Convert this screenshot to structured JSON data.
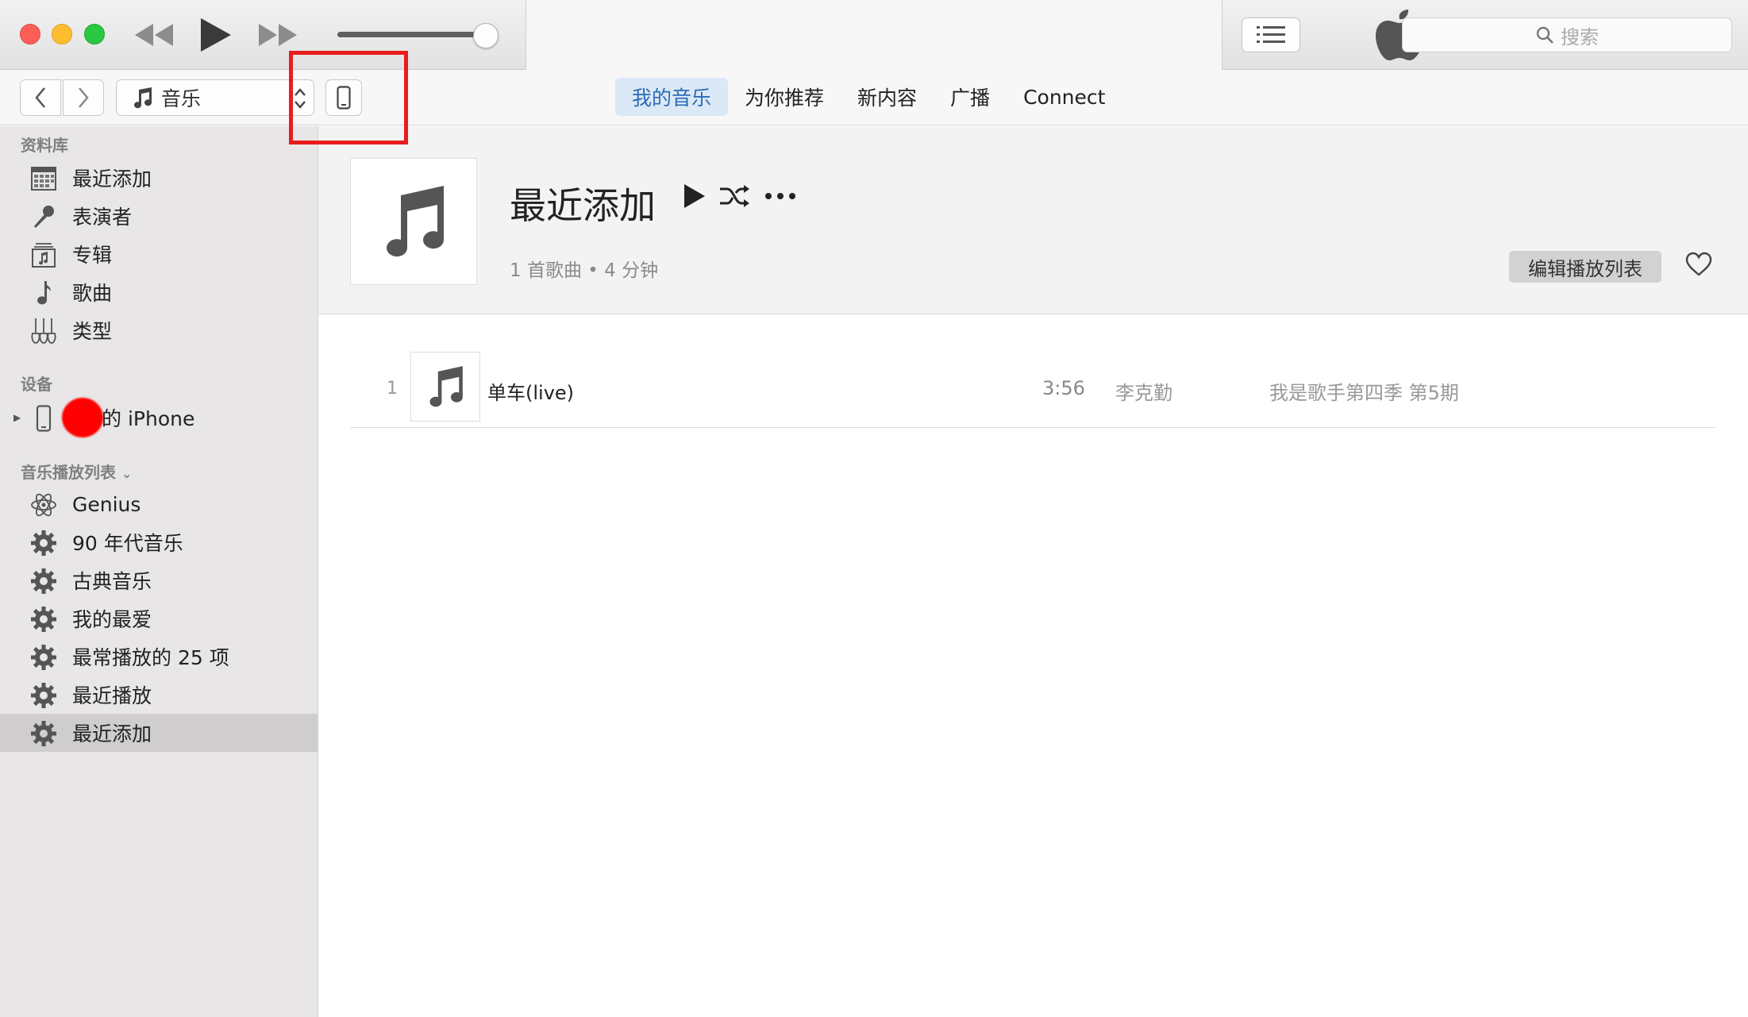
{
  "search": {
    "placeholder": "搜索"
  },
  "nav": {
    "media_label": "音乐",
    "tabs": [
      "我的音乐",
      "为你推荐",
      "新内容",
      "广播",
      "Connect"
    ],
    "active_tab": "我的音乐"
  },
  "sidebar": {
    "library_title": "资料库",
    "library": [
      {
        "label": "最近添加",
        "icon": "calendar-grid-icon"
      },
      {
        "label": "表演者",
        "icon": "microphone-icon"
      },
      {
        "label": "专辑",
        "icon": "album-stack-icon"
      },
      {
        "label": "歌曲",
        "icon": "music-note-icon"
      },
      {
        "label": "类型",
        "icon": "guitar-icon"
      }
    ],
    "devices_title": "设备",
    "device": {
      "label": "的 iPhone",
      "icon": "iphone-icon"
    },
    "playlists_title": "音乐播放列表",
    "playlists": [
      {
        "label": "Genius",
        "icon": "genius-atom-icon"
      },
      {
        "label": "90 年代音乐",
        "icon": "gear-icon"
      },
      {
        "label": "古典音乐",
        "icon": "gear-icon"
      },
      {
        "label": "我的最爱",
        "icon": "gear-icon"
      },
      {
        "label": "最常播放的 25 项",
        "icon": "gear-icon"
      },
      {
        "label": "最近播放",
        "icon": "gear-icon"
      },
      {
        "label": "最近添加",
        "icon": "gear-icon"
      }
    ],
    "selected_playlist": "最近添加"
  },
  "playlist": {
    "title": "最近添加",
    "meta": "1 首歌曲 • 4 分钟",
    "edit_label": "编辑播放列表"
  },
  "tracks": [
    {
      "num": "1",
      "name": "单车(live)",
      "duration": "3:56",
      "artist": "李克勤",
      "album": "我是歌手第四季 第5期"
    }
  ],
  "colors": {
    "accent": "#2b6cb4",
    "highlight_box": "#e81c1c"
  }
}
